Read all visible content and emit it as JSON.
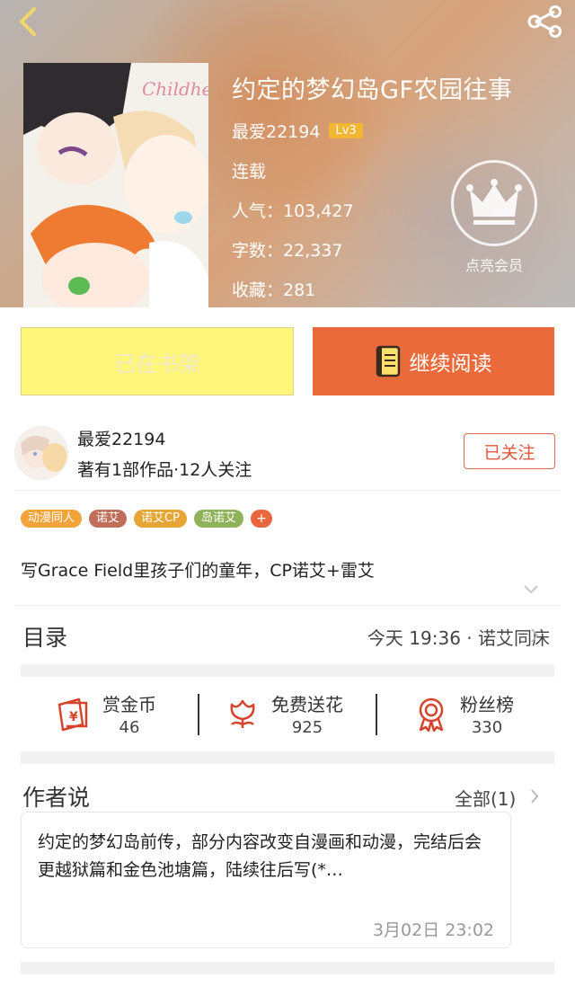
{
  "header": {
    "book_title": "约定的梦幻岛GF农园往事",
    "author_name": "最爱22194",
    "level": "Lv3",
    "status": "连载",
    "popularity": "人气：103,427",
    "word_count": "字数：22,337",
    "favorites": "收藏：281",
    "vip_label": "点亮会员",
    "cover_text": "Childhe"
  },
  "actions": {
    "shelf_label": "已在书架",
    "read_label": "继续阅读"
  },
  "author": {
    "name": "最爱22194",
    "meta": "著有1部作品·12人关注",
    "follow_label": "已关注"
  },
  "tags": [
    {
      "label": "动漫同人",
      "color": "#f2a33a"
    },
    {
      "label": "诺艾",
      "color": "#c06e5a"
    },
    {
      "label": "诺艾CP",
      "color": "#e6a534"
    },
    {
      "label": "岛诺艾",
      "color": "#8fb35a"
    }
  ],
  "tag_more": "+",
  "description": "写Grace Field里孩子们的童年，CP诺艾+雷艾",
  "toc": {
    "label": "目录",
    "latest": "今天 19:36 · 诺艾同床"
  },
  "rewards": [
    {
      "label": "赏金币",
      "value": "46",
      "icon": "coin-envelope-icon"
    },
    {
      "label": "免费送花",
      "value": "925",
      "icon": "flower-icon"
    },
    {
      "label": "粉丝榜",
      "value": "330",
      "icon": "medal-icon"
    }
  ],
  "author_says": {
    "label": "作者说",
    "all": "全部(1)",
    "text": "约定的梦幻岛前传，部分内容改变自漫画和动漫，完结后会更越狱篇和金色池塘篇，陆续往后写(*…",
    "date": "3月02日  23:02"
  },
  "colors": {
    "accent": "#eb6a3c",
    "shelf": "#fff67a",
    "level_badge": "#f3b534"
  }
}
